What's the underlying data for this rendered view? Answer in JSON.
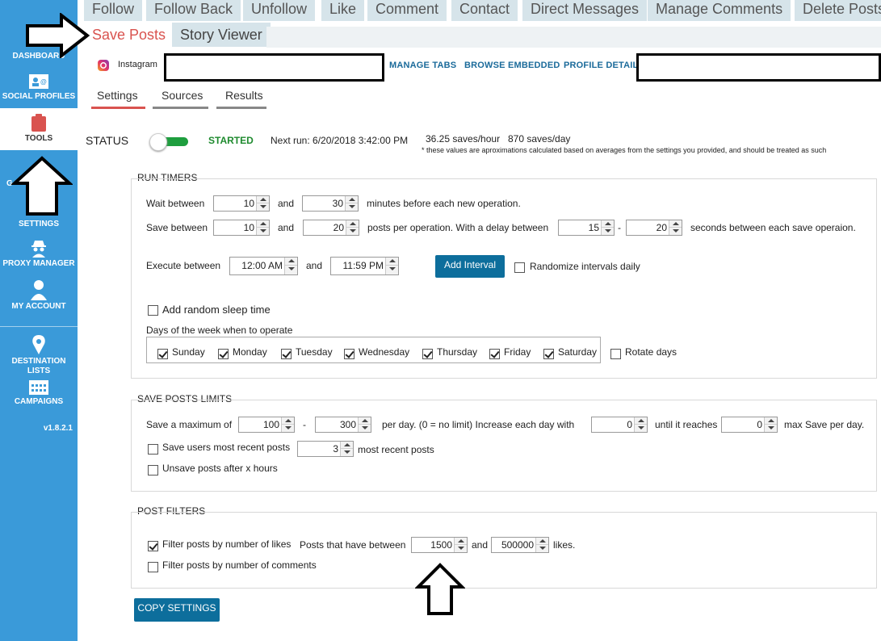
{
  "sidebar": {
    "items": [
      {
        "label": "DASHBOARD",
        "icon": "dashboard-icon"
      },
      {
        "label": "SOCIAL PROFILES",
        "icon": "social-profiles-icon"
      },
      {
        "label": "TOOLS",
        "icon": "clipboard-icon"
      },
      {
        "label": "G",
        "icon": "groups-icon"
      },
      {
        "label": "SETTINGS",
        "icon": "gear-icon"
      },
      {
        "label": "PROXY MANAGER",
        "icon": "spy-icon"
      },
      {
        "label": "MY ACCOUNT",
        "icon": "user-icon"
      },
      {
        "label": "DESTINATION LISTS",
        "icon": "map-pin-icon"
      },
      {
        "label": "CAMPAIGNS",
        "icon": "calendar-icon"
      }
    ],
    "version": "v1.8.2.1"
  },
  "tabs_row1": [
    "Follow",
    "Follow Back",
    "Unfollow",
    "Like",
    "Comment",
    "Contact",
    "Direct Messages",
    "Manage Comments",
    "Delete Posts"
  ],
  "tabs_row2": [
    {
      "label": "Save Posts",
      "active": true
    },
    {
      "label": "Story Viewer",
      "active": false
    }
  ],
  "profile": {
    "network": "Instagram",
    "links": [
      "MANAGE TABS",
      "BROWSE EMBEDDED",
      "PROFILE DETAILS"
    ]
  },
  "subtabs": [
    {
      "label": "Settings",
      "active": true
    },
    {
      "label": "Sources",
      "active": false
    },
    {
      "label": "Results",
      "active": false
    }
  ],
  "status": {
    "label": "STATUS",
    "state": "STARTED",
    "next_run": "Next run: 6/20/2018 3:42:00 PM",
    "per_hour": "36.25 saves/hour",
    "per_day": "870 saves/day",
    "note": "* these values are aproximations calculated based on averages from the settings you provided, and should be treated as such"
  },
  "run_timers": {
    "title": "RUN TIMERS",
    "wait_label": "Wait between",
    "wait_min": "10",
    "and1": "and",
    "wait_max": "30",
    "wait_suffix": "minutes before each new operation.",
    "save_label": "Save between",
    "save_min": "10",
    "and2": "and",
    "save_max": "20",
    "save_suffix": "posts per operation.  With a delay between",
    "delay_min": "15",
    "dash": "-",
    "delay_max": "20",
    "delay_suffix": "seconds between each save operaion.",
    "exec_label": "Execute between",
    "exec_start": "12:00 AM",
    "and3": "and",
    "exec_end": "11:59 PM",
    "add_interval": "Add Interval",
    "randomize": "Randomize intervals daily",
    "random_sleep": "Add random sleep time",
    "days_label": "Days of the week when to operate",
    "days": [
      {
        "label": "Sunday",
        "checked": true
      },
      {
        "label": "Monday",
        "checked": true
      },
      {
        "label": "Tuesday",
        "checked": true
      },
      {
        "label": "Wednesday",
        "checked": true
      },
      {
        "label": "Thursday",
        "checked": true
      },
      {
        "label": "Friday",
        "checked": true
      },
      {
        "label": "Saturday",
        "checked": true
      }
    ],
    "rotate_days": "Rotate days"
  },
  "limits": {
    "title": "SAVE POSTS LIMITS",
    "max_label": "Save a maximum of",
    "max_min": "100",
    "dash": "-",
    "max_max": "300",
    "per_day": "per day. (0 = no limit)   Increase each day with",
    "increase": "0",
    "until": "until it reaches",
    "reaches": "0",
    "max_save": "max Save per day.",
    "recent_label": "Save users most recent posts",
    "recent_count": "3",
    "recent_suffix": "most recent posts",
    "unsave_label": "Unsave posts after x hours"
  },
  "filters": {
    "title": "POST FILTERS",
    "likes_label": "Filter posts by number of likes",
    "between_label": "Posts that have between",
    "likes_min": "1500",
    "and": "and",
    "likes_max": "500000",
    "likes_suffix": "likes.",
    "comments_label": "Filter posts by number of comments"
  },
  "copy_settings": "COPY SETTINGS",
  "colors": {
    "sidebar": "#3a9ad9",
    "accent": "#0d6e9c",
    "active_tab": "#d9534f",
    "started": "#1e8a2e"
  }
}
